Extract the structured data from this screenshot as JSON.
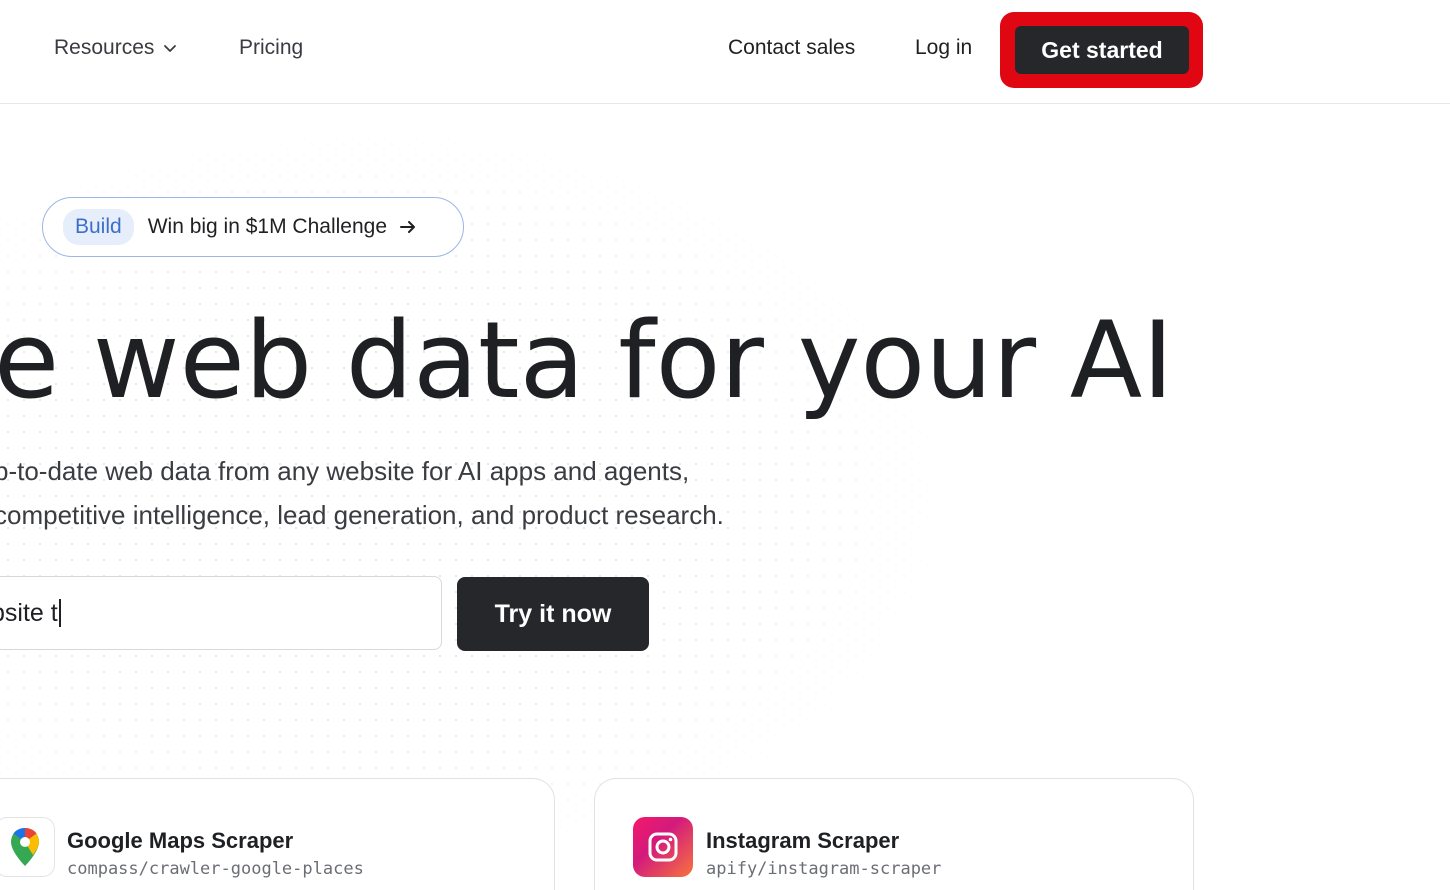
{
  "header": {
    "nav_items": [
      {
        "label": "Resources",
        "icon": "chevron-down-icon"
      },
      {
        "label": "Pricing"
      }
    ],
    "contact_sales": "Contact sales",
    "log_in": "Log in",
    "get_started": "Get started",
    "highlight_color": "#e00612"
  },
  "announcement": {
    "tag": "Build",
    "text": "Win big in $1M Challenge",
    "icon": "arrow-right-icon"
  },
  "hero": {
    "title": "e web data for your AI",
    "subtitle_line1": "p-to-date web data from any website for AI apps and agents,",
    "subtitle_line2": "competitive intelligence, lead generation, and product research."
  },
  "try_form": {
    "input_value": "bsite t",
    "button_label": "Try it now"
  },
  "cards": [
    {
      "title": "Google Maps Scraper",
      "slug": "compass/crawler-google-places",
      "icon": "google-maps-pin-icon"
    },
    {
      "title": "Instagram Scraper",
      "slug": "apify/instagram-scraper",
      "icon": "instagram-icon"
    }
  ],
  "colors": {
    "dark_button": "#26272b",
    "pill_border": "#9db6e6",
    "pill_tag_bg": "#e6eefb",
    "pill_tag_text": "#3d6fc9"
  }
}
